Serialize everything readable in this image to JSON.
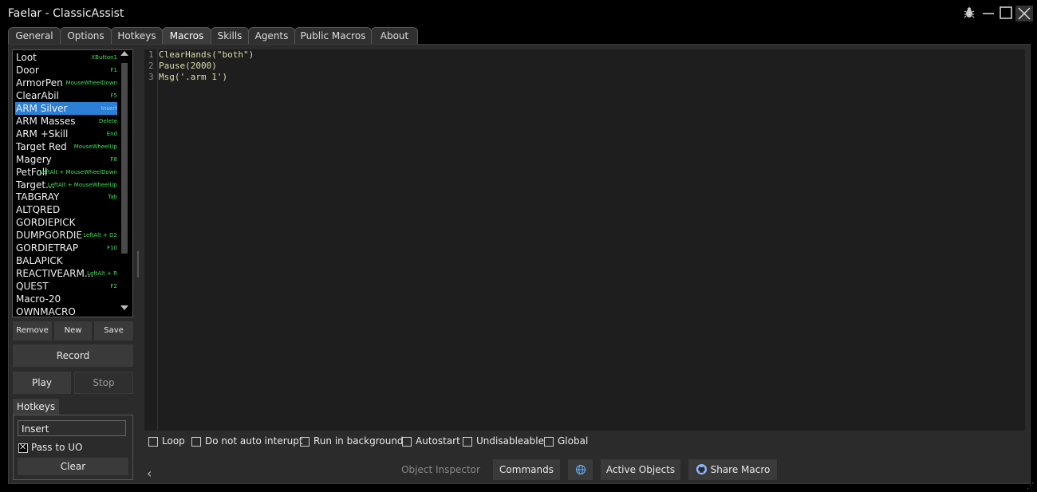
{
  "window": {
    "title": "Faelar - ClassicAssist"
  },
  "tabs": [
    "General",
    "Options",
    "Hotkeys",
    "Macros",
    "Skills",
    "Agents",
    "Public Macros",
    "About"
  ],
  "macros": [
    {
      "name": "Loot",
      "hotkey": "XButton1"
    },
    {
      "name": "Door",
      "hotkey": "F1"
    },
    {
      "name": "ArmorPen",
      "hotkey": "MouseWheelDown"
    },
    {
      "name": "ClearAbil",
      "hotkey": "F5"
    },
    {
      "name": "ARM Silver",
      "hotkey": "Insert"
    },
    {
      "name": "ARM Masses",
      "hotkey": "Delete"
    },
    {
      "name": "ARM +Skill",
      "hotkey": "End"
    },
    {
      "name": "Target Red",
      "hotkey": "MouseWheelUp"
    },
    {
      "name": "Magery",
      "hotkey": "F8"
    },
    {
      "name": "PetFoll",
      "hotkey": "LeftAlt + MouseWheelDown"
    },
    {
      "name": "Target...",
      "hotkey": "LeftAlt + MouseWheelUp"
    },
    {
      "name": "TABGRAY",
      "hotkey": "Tab"
    },
    {
      "name": "ALTQRED",
      "hotkey": ""
    },
    {
      "name": "GORDIEPICK",
      "hotkey": ""
    },
    {
      "name": "DUMPGORDIE",
      "hotkey": "LeftAlt + D2"
    },
    {
      "name": "GORDIETRAP",
      "hotkey": "F10"
    },
    {
      "name": "BALAPICK",
      "hotkey": ""
    },
    {
      "name": "REACTIVEARM...",
      "hotkey": "LeftAlt + R"
    },
    {
      "name": "QUEST",
      "hotkey": "F2"
    },
    {
      "name": "Macro-20",
      "hotkey": ""
    },
    {
      "name": "OWNMACRO",
      "hotkey": ""
    }
  ],
  "buttons": {
    "remove": "Remove",
    "new": "New",
    "save": "Save",
    "record": "Record",
    "play": "Play",
    "stop": "Stop"
  },
  "hotkeys": {
    "tab": "Hotkeys",
    "value": "Insert",
    "pass_to_uo": "Pass to UO",
    "clear": "Clear"
  },
  "code_lines": [
    "ClearHands(\"both\")",
    "Pause(2000)",
    "Msg('.arm 1')"
  ],
  "options": [
    "Loop",
    "Do not auto interupt",
    "Run in background",
    "Autostart",
    "Undisableable",
    "Global"
  ],
  "footer": {
    "object_inspector": "Object Inspector",
    "commands": "Commands",
    "active_objects": "Active Objects",
    "share_macro": "Share Macro"
  },
  "colors": {
    "selection": "#2b7fd4",
    "hotkey_text": "#3ee05a",
    "code_text": "#dcdcaa"
  }
}
